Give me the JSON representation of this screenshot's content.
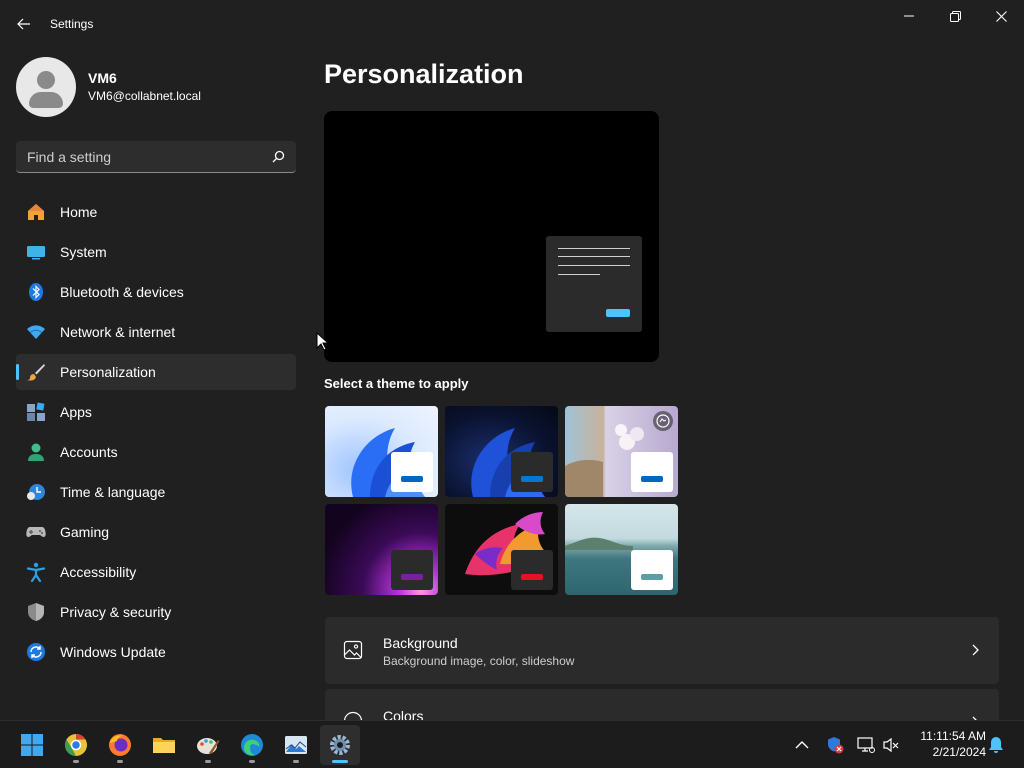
{
  "window": {
    "title": "Settings",
    "back_icon": "back-arrow-icon",
    "controls": [
      "minimize-icon",
      "restore-icon",
      "close-icon"
    ]
  },
  "profile": {
    "name": "VM6",
    "email": "VM6@collabnet.local"
  },
  "search": {
    "placeholder": "Find a setting",
    "value": ""
  },
  "sidebar": {
    "items": [
      {
        "label": "Home",
        "icon": "home-icon",
        "selected": false
      },
      {
        "label": "System",
        "icon": "system-icon",
        "selected": false
      },
      {
        "label": "Bluetooth & devices",
        "icon": "bluetooth-icon",
        "selected": false
      },
      {
        "label": "Network & internet",
        "icon": "network-icon",
        "selected": false
      },
      {
        "label": "Personalization",
        "icon": "brush-icon",
        "selected": true
      },
      {
        "label": "Apps",
        "icon": "apps-icon",
        "selected": false
      },
      {
        "label": "Accounts",
        "icon": "accounts-icon",
        "selected": false
      },
      {
        "label": "Time & language",
        "icon": "time-language-icon",
        "selected": false
      },
      {
        "label": "Gaming",
        "icon": "gaming-icon",
        "selected": false
      },
      {
        "label": "Accessibility",
        "icon": "accessibility-icon",
        "selected": false
      },
      {
        "label": "Privacy & security",
        "icon": "shield-icon",
        "selected": false
      },
      {
        "label": "Windows Update",
        "icon": "windows-update-icon",
        "selected": false
      }
    ]
  },
  "main": {
    "title": "Personalization",
    "theme_section_label": "Select a theme to apply",
    "themes": [
      {
        "name": "windows-light",
        "accent": "#0067c0"
      },
      {
        "name": "windows-dark",
        "accent": "#0078d4"
      },
      {
        "name": "spotlight",
        "accent": "#0067c0"
      },
      {
        "name": "glow",
        "accent": "#7a1fa2"
      },
      {
        "name": "captured-motion",
        "accent": "#e81123"
      },
      {
        "name": "flow",
        "accent": "#5a9ea6"
      }
    ],
    "cards": [
      {
        "title": "Background",
        "description": "Background image, color, slideshow",
        "icon": "image-icon"
      },
      {
        "title": "Colors",
        "description": "",
        "icon": "palette-icon"
      }
    ]
  },
  "taskbar": {
    "apps": [
      "start-icon",
      "chrome-icon",
      "firefox-icon",
      "file-explorer-icon",
      "paint-icon",
      "edge-icon",
      "photos-icon",
      "settings-icon"
    ],
    "active_app": "settings-icon",
    "tray": [
      "chevron-up-icon",
      "security-icon",
      "display-icon",
      "volume-muted-icon"
    ],
    "time": "11:11:54 AM",
    "date": "2/21/2024",
    "notification_icon": "bell-icon"
  },
  "colors": {
    "accent": "#4cc2ff",
    "background": "#202020",
    "card": "#2b2b2b"
  }
}
